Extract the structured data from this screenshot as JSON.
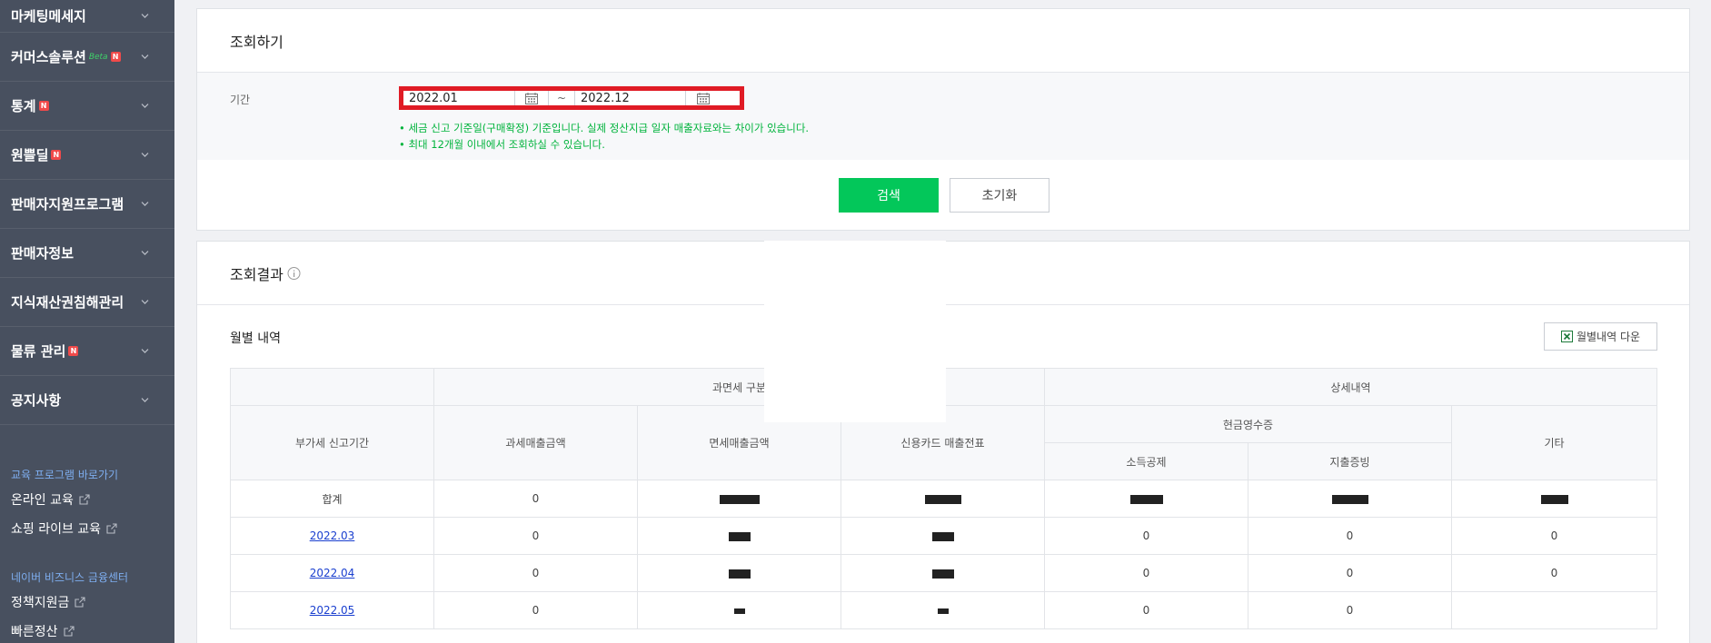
{
  "sidebar": {
    "menu": [
      {
        "label": "마케팅메세지",
        "badge": "",
        "beta": ""
      },
      {
        "label": "커머스솔루션",
        "badge": "N",
        "beta": "Beta"
      },
      {
        "label": "통계",
        "badge": "N",
        "beta": ""
      },
      {
        "label": "원쁠딜",
        "badge": "N",
        "beta": ""
      },
      {
        "label": "판매자지원프로그램",
        "badge": "",
        "beta": ""
      },
      {
        "label": "판매자정보",
        "badge": "",
        "beta": ""
      },
      {
        "label": "지식재산권침해관리",
        "badge": "",
        "beta": ""
      },
      {
        "label": "물류 관리",
        "badge": "N",
        "beta": ""
      },
      {
        "label": "공지사항",
        "badge": "",
        "beta": ""
      }
    ],
    "edu_section": "교육 프로그램 바로가기",
    "edu_links": [
      "온라인 교육",
      "쇼핑 라이브 교육"
    ],
    "finance_section": "네이버 비즈니스 금융센터",
    "finance_links": [
      "정책지원금",
      "빠른정산"
    ]
  },
  "search_panel": {
    "title": "조회하기",
    "period_label": "기간",
    "start_date": "2022.01",
    "end_date": "2022.12",
    "tilde": "~",
    "notice_1": "• 세금 신고 기준일(구매확정) 기준입니다. 실제 정산지급 일자 매출자료와는 차이가 있습니다.",
    "notice_2": "• 최대 12개월 이내에서 조회하실 수 있습니다.",
    "search_button": "검색",
    "reset_button": "초기화"
  },
  "result_panel": {
    "title": "조회결과",
    "subtitle": "월별 내역",
    "download_button": "월별내역 다운",
    "headers": {
      "group_tax": "과면세 구분",
      "group_detail": "상세내역",
      "period": "부가세 신고기간",
      "taxable": "과세매출금액",
      "taxfree": "면세매출금액",
      "card": "신용카드 매출전표",
      "cash_group": "현금영수증",
      "income": "소득공제",
      "expense": "지출증빙",
      "etc": "기타"
    },
    "rows": [
      {
        "period": "합계",
        "taxable": "0",
        "taxfree": "",
        "card": "",
        "income": "",
        "expense": "",
        "etc": "",
        "link": false
      },
      {
        "period": "2022.03",
        "taxable": "0",
        "taxfree": "",
        "card": "",
        "income": "0",
        "expense": "0",
        "etc": "0",
        "link": true
      },
      {
        "period": "2022.04",
        "taxable": "0",
        "taxfree": "",
        "card": "",
        "income": "0",
        "expense": "0",
        "etc": "0",
        "link": true
      },
      {
        "period": "2022.05",
        "taxable": "0",
        "taxfree": "",
        "card": "",
        "income": "0",
        "expense": "0",
        "etc": "",
        "link": true
      }
    ]
  },
  "colors": {
    "sidebar_bg": "#48505f",
    "accent_green": "#03c75a",
    "notice_green": "#00b33c",
    "highlight_red": "#e01b25",
    "link_blue": "#1a3fcf"
  }
}
